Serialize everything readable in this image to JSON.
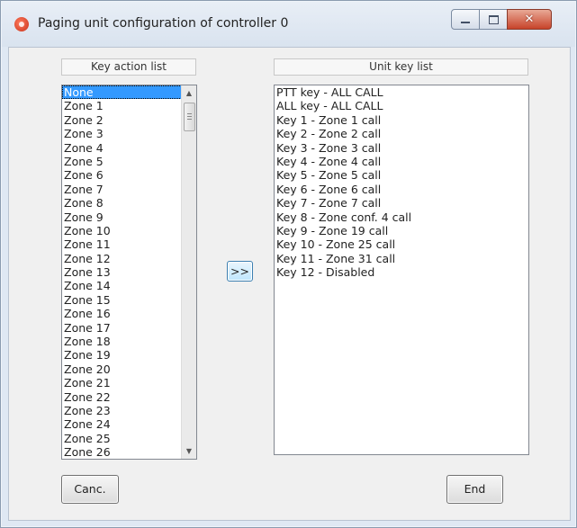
{
  "window": {
    "title": "Paging unit configuration of controller 0",
    "icon": "app-icon",
    "controls": {
      "minimize": "minimize-icon",
      "maximize": "maximize-icon",
      "close": "close-icon",
      "close_glyph": "✕"
    }
  },
  "key_action_list": {
    "header": "Key action list",
    "selected_index": 0,
    "items": [
      "None",
      "Zone 1",
      "Zone 2",
      "Zone 3",
      "Zone 4",
      "Zone 5",
      "Zone 6",
      "Zone 7",
      "Zone 8",
      "Zone 9",
      "Zone 10",
      "Zone 11",
      "Zone 12",
      "Zone 13",
      "Zone 14",
      "Zone 15",
      "Zone 16",
      "Zone 17",
      "Zone 18",
      "Zone 19",
      "Zone 20",
      "Zone 21",
      "Zone 22",
      "Zone 23",
      "Zone 24",
      "Zone 25",
      "Zone 26"
    ]
  },
  "unit_key_list": {
    "header": "Unit key list",
    "items": [
      "PTT key - ALL CALL",
      "ALL key - ALL CALL",
      "Key 1 - Zone 1 call",
      "Key 2 - Zone 2 call",
      "Key 3 - Zone 3 call",
      "Key 4 - Zone 4 call",
      "Key 5 - Zone 5 call",
      "Key 6 - Zone 6 call",
      "Key 7 - Zone 7 call",
      "Key 8 - Zone conf. 4 call",
      "Key 9 - Zone 19 call",
      "Key 10 - Zone 25 call",
      "Key 11 - Zone 31 call",
      "Key 12 - Disabled"
    ]
  },
  "buttons": {
    "move": ">>",
    "cancel": "Canc.",
    "end": "End"
  },
  "colors": {
    "selection": "#3399ff",
    "titlebar": "#dfe8f3",
    "close_button": "#c7432a"
  }
}
